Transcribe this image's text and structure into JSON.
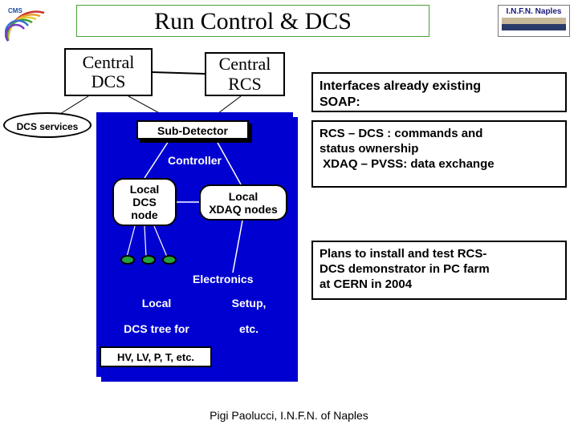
{
  "title": "Run Control & DCS",
  "logos": {
    "cms_label": "CMS",
    "infn_label": "I.N.F.N. Naples"
  },
  "diagram": {
    "central_dcs": {
      "line1": "Central",
      "line2": "DCS"
    },
    "central_rcs": {
      "line1": "Central",
      "line2": "RCS"
    },
    "dcs_services": "DCS services",
    "blue_panel": {
      "sub_detector": "Sub-Detector",
      "controller": "Controller",
      "local_dcs": {
        "line1": "Local",
        "line2": "DCS",
        "line3": "node"
      },
      "local_xdaq": {
        "line1": "Local",
        "line2": "XDAQ nodes"
      },
      "electronics": "Electronics",
      "local": "Local",
      "dcs_tree_for": "DCS tree for",
      "setup": "Setup,",
      "etc": "etc.",
      "hvlv": "HV, LV, P, T, etc."
    }
  },
  "info_boxes": {
    "box1": {
      "line1": "Interfaces already existing",
      "line2": "SOAP:"
    },
    "box2": {
      "line1": "RCS – DCS : commands and",
      "line2": "status ownership",
      "line3": " XDAQ – PVSS: data exchange"
    },
    "box3": {
      "line1": "Plans to install and test RCS-",
      "line2": "DCS demonstrator in PC farm",
      "line3": "at CERN in 2004"
    }
  },
  "footer": "Pigi Paolucci, I.N.F.N. of Naples"
}
